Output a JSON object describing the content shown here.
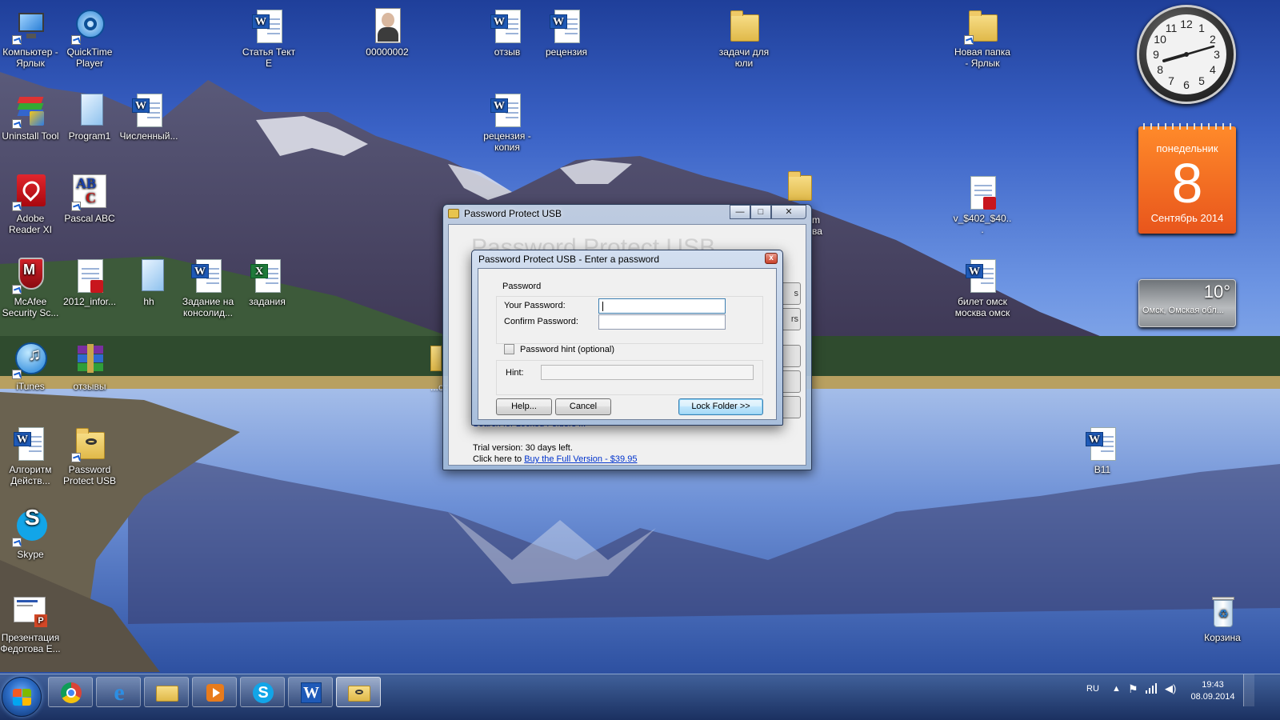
{
  "desktop": {
    "icons": [
      {
        "label": "Компьютер - Ярлык"
      },
      {
        "label": "QuickTime Player"
      },
      {
        "label": "Статья Тект Е"
      },
      {
        "label": "00000002"
      },
      {
        "label": "отзыв"
      },
      {
        "label": "рецензия"
      },
      {
        "label": "задачи для юли"
      },
      {
        "label": "Новая папка - Ярлык"
      },
      {
        "label": "Uninstall Tool"
      },
      {
        "label": "Program1"
      },
      {
        "label": "Численный..."
      },
      {
        "label": "рецензия - копия"
      },
      {
        "label": "Adobe Reader XI"
      },
      {
        "label": "Pascal ABC"
      },
      {
        "label": "v_$402_$40..."
      },
      {
        "label": "McAfee Security Sc..."
      },
      {
        "label": "2012_infor..."
      },
      {
        "label": "hh"
      },
      {
        "label": "Задание на консолид..."
      },
      {
        "label": "задания"
      },
      {
        "label": "билет омск москва омск"
      },
      {
        "label": "iTunes"
      },
      {
        "label": "отзывы"
      },
      {
        "label": "Алгоритм Действ..."
      },
      {
        "label": "Password Protect USB"
      },
      {
        "label": "B11"
      },
      {
        "label": "Skype"
      },
      {
        "label": "Презентация Федотова Е..."
      },
      {
        "label": "Корзина"
      }
    ],
    "partial_labels": {
      "left_folder": "...от",
      "behind_window": "m",
      "behind_window2": "ва"
    }
  },
  "gadgets": {
    "clock": {
      "hours": [
        "12",
        "1",
        "2",
        "3",
        "4",
        "5",
        "6",
        "7",
        "8",
        "9",
        "10",
        "11"
      ]
    },
    "calendar": {
      "day_name": "понедельник",
      "day_number": "8",
      "month_year": "Сентябрь 2014"
    },
    "weather": {
      "temperature": "10°",
      "city": "Омск, Омская обл..."
    }
  },
  "main_window": {
    "title": "Password Protect USB",
    "ghost_heading": "Password Protect USB",
    "side_button_1": "s",
    "side_button_2": "rs",
    "link_partial": "Search for Locked Folders ...",
    "trial_line_1": "Trial version: 30 days left.",
    "trial_line_2_prefix": "Click here to",
    "trial_link": "Buy the Full Version - $39.95",
    "minimize_glyph": "—",
    "maximize_glyph": "□",
    "close_glyph": "✕"
  },
  "dialog": {
    "title": "Password Protect USB - Enter a password",
    "close_glyph": "x",
    "password_group": "Password",
    "your_password_label": "Your Password:",
    "your_password_value": "",
    "confirm_password_label": "Confirm Password:",
    "confirm_password_value": "",
    "hint_checkbox_label": "Password hint (optional)",
    "hint_checked": false,
    "hint_label": "Hint:",
    "hint_value": "",
    "help_button": "Help...",
    "cancel_button": "Cancel",
    "lock_button": "Lock Folder >>"
  },
  "taskbar": {
    "pinned": [
      "chrome-icon",
      "internet-explorer-icon",
      "explorer-icon",
      "media-player-icon",
      "skype-icon",
      "word-icon",
      "password-protect-usb-icon"
    ],
    "language": "RU",
    "time": "19:43",
    "date": "08.09.2014"
  },
  "colors": {
    "calendar_orange": "#e8551c",
    "link_blue": "#0033cc",
    "default_button_border": "#3c7fb1"
  }
}
